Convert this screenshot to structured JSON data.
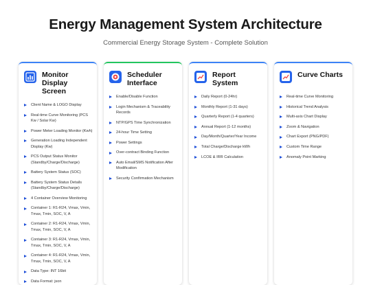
{
  "header": {
    "title": "Energy Management System Architecture",
    "subtitle": "Commercial Energy Storage System - Complete Solution"
  },
  "cards": [
    {
      "title": "Monitor Display Screen",
      "icon": "monitor-chart-icon",
      "items": [
        "Client Name & LOGO Display",
        "Real-time Curve Monitoring (PCS Kw / Solar Kw)",
        "Power Meter Loading Monitor (Kwh)",
        "Generation Loading Independent Display (Kw)",
        "PCS Output Status Monitor (Standby/Charge/Discharge)",
        "Battery System Status (SOC)",
        "Battery System Status Details (Standby/Charge/Discharge)",
        "4 Container Overview Monitoring",
        "Container 1: R1-R24, Vmax, Vmin, Tmax, Tmin, SOC, V, A",
        "Container 2: R1-R24, Vmax, Vmin, Tmax, Tmin, SOC, V, A",
        "Container 3: R1-R24, Vmax, Vmin, Tmax, Tmin, SOC, V, A",
        "Container 4: R1-R24, Vmax, Vmin, Tmax, Tmin, SOC, V, A",
        "Data Type: INT 16bit",
        "Data Format: json"
      ]
    },
    {
      "title": "Scheduler Interface",
      "icon": "target-icon",
      "items": [
        "Enable/Disable Function",
        "Login Mechanism & Traceability Records",
        "NTP/GPS Time Synchronization",
        "24-hour Time Setting",
        "Power Settings",
        "Over-contract Binding Function",
        "Auto Email/SMS Notification After Modification",
        "Security Confirmation Mechanism"
      ]
    },
    {
      "title": "Report System",
      "icon": "trend-chart-icon",
      "items": [
        "Daily Report (0-24hr)",
        "Monthly Report (1-31 days)",
        "Quarterly Report (1-4 quarters)",
        "Annual Report (1-12 months)",
        "Day/Month/Quarter/Year Income",
        "Total Charge/Discharge kWh",
        "LCOE & IRR Calculation"
      ]
    },
    {
      "title": "Curve Charts",
      "icon": "trend-chart-icon",
      "items": [
        "Real-time Curve Monitoring",
        "Historical Trend Analysis",
        "Multi-axis Chart Display",
        "Zoom & Navigation",
        "Chart Export (PNG/PDF)",
        "Custom Time Range",
        "Anomaly Point Marking"
      ]
    }
  ]
}
